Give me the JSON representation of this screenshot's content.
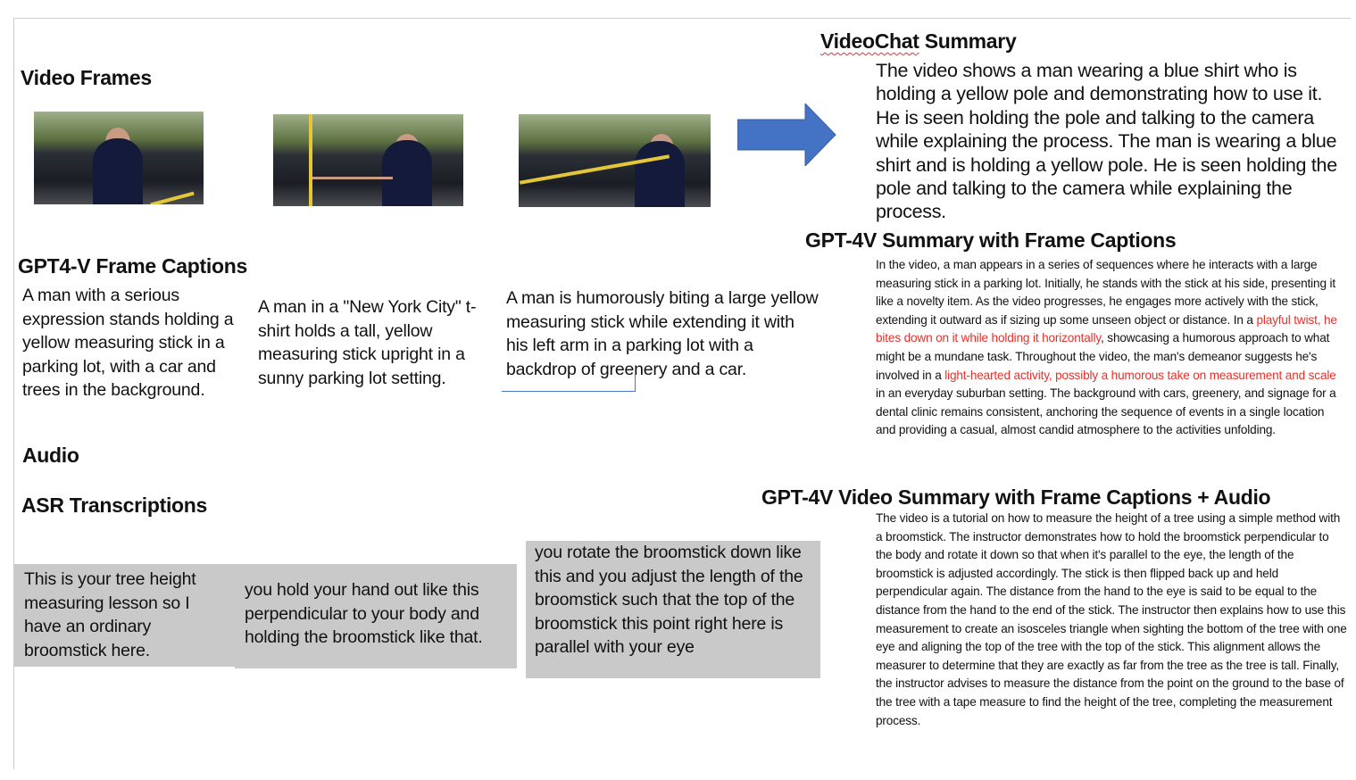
{
  "headings": {
    "video_frames": "Video Frames",
    "frame_captions": "GPT4-V Frame Captions",
    "audio": "Audio",
    "asr": "ASR Transcriptions",
    "videochat_summary_a": "VideoChat",
    "videochat_summary_b": " Summary",
    "gpt4v_summary": "GPT-4V Summary with Frame Captions",
    "gpt4v_audio_summary": "GPT-4V Video Summary with Frame Captions + Audio"
  },
  "frame_captions": [
    "A man with a serious expression stands holding a yellow measuring stick in a parking lot, with a car and trees in the background.",
    "A man in a \"New York City\" t-shirt holds a tall, yellow measuring stick upright in a sunny parking lot setting.",
    "A man is humorously biting a large yellow measuring stick while extending it with his left arm in a parking lot with a backdrop of greenery and a car."
  ],
  "asr": [
    "This is your tree height measuring lesson so I have an ordinary broomstick here.",
    "you hold your hand out like this perpendicular to your body and holding the broomstick like that.",
    "you rotate the broomstick down like this and you adjust the length of the broomstick such that the top of the broomstick this point right here is parallel with your eye"
  ],
  "videochat_summary": "The video shows a man wearing a blue shirt who is holding a yellow pole and demonstrating how to use it. He is seen holding the pole and talking to the camera while explaining the process. The man is wearing a blue shirt and is holding a yellow pole. He is seen holding the pole and talking to the camera while explaining the process.",
  "gpt4v_summary": [
    "In the video, a man appears in a series of sequences where he interacts with a large measuring stick in a parking lot. Initially, he stands with the stick at his side, presenting it like a novelty item. As the video progresses, he engages more actively with the stick, extending it outward as if sizing up some unseen object or distance. In a ",
    "playful twist, he bites down on it while holding it horizontally",
    ", showcasing a humorous approach to what might be a mundane task. Throughout the video, the man's demeanor suggests he's involved in a ",
    "light-hearted activity, possibly a humorous take on measurement and scale",
    " in an everyday suburban setting. The background with cars, greenery, and signage for a dental clinic remains consistent, anchoring the sequence of events in a single location and providing a casual, almost candid atmosphere to the activities unfolding."
  ],
  "gpt4v_audio_summary": "The video is a tutorial on how to measure the height of a tree using a simple method with a broomstick. The instructor demonstrates how to hold the broomstick perpendicular to the body and rotate it down so that when it's parallel to the eye, the length of the broomstick is adjusted accordingly. The stick is then flipped back up and held perpendicular again. The distance from the hand to the eye is said to be equal to the distance from the hand to the end of the stick. The instructor then explains how to use this measurement to create an isosceles triangle when sighting the bottom of the tree with one eye and aligning the top of the tree with the top of the stick. This alignment allows the measurer to determine that they are exactly as far from the tree as the tree is tall. Finally, the instructor advises to measure the distance from the point on the ground to the base of the tree with a tape measure to find the height of the tree, completing the measurement process.",
  "colors": {
    "arrow": "#4472c4",
    "highlight": "#e8302a",
    "asr_box": "#c9c9c9"
  }
}
